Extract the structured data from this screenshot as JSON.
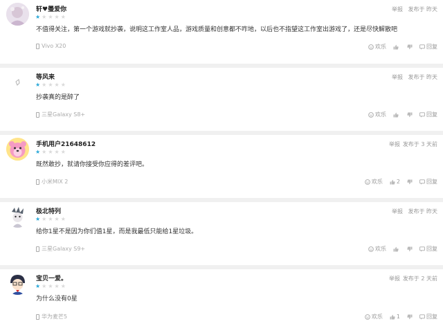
{
  "reviews": [
    {
      "username": "轩♥璺爱你",
      "rating": 1,
      "report": "举报",
      "posted": "发布于 昨天",
      "content": "不值得关注，第一个游戏就抄袭，说明这工作室人品，游戏质量和创意都不咋地，以后也不指望这工作室出游戏了，还是尽快解散吧",
      "device": "Vivo X20",
      "fun_label": "欢乐",
      "like_count": "",
      "reply_label": "回复"
    },
    {
      "username": "等风来",
      "rating": 1,
      "report": "举报",
      "posted": "发布于 昨天",
      "content": "抄袭真的是醉了",
      "device": "三星Galaxy S8+",
      "fun_label": "欢乐",
      "like_count": "",
      "reply_label": "回复"
    },
    {
      "username": "手机用户21648612",
      "rating": 1,
      "report": "举报",
      "posted": "发布于 3 天前",
      "content": "既然敢抄，就请你接受你应得的差评吧。",
      "device": "小米MIX 2",
      "fun_label": "欢乐",
      "like_count": "2",
      "reply_label": "回复"
    },
    {
      "username": "极北特列",
      "rating": 1,
      "report": "举报",
      "posted": "发布于 昨天",
      "content": "给你1星不是因为你们值1星，而是我最低只能给1星垃圾。",
      "device": "三星Galaxy S9+",
      "fun_label": "欢乐",
      "like_count": "",
      "reply_label": "回复"
    },
    {
      "username": "宝贝一爱。",
      "rating": 1,
      "report": "举报",
      "posted": "发布于 2 天前",
      "content": "为什么没有0星",
      "device": "华为麦芒5",
      "fun_label": "欢乐",
      "like_count": "1",
      "reply_label": "回复"
    }
  ]
}
